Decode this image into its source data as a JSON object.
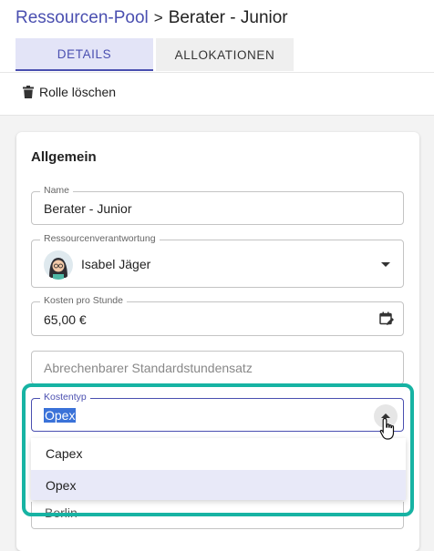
{
  "breadcrumb": {
    "parent": "Ressourcen-Pool",
    "separator": ">",
    "current": "Berater - Junior"
  },
  "tabs": [
    {
      "label": "DETAILS",
      "active": true
    },
    {
      "label": "ALLOKATIONEN",
      "active": false
    }
  ],
  "toolbar": {
    "delete_label": "Rolle löschen",
    "delete_icon": "trash-icon"
  },
  "section": {
    "title": "Allgemein"
  },
  "fields": {
    "name": {
      "label": "Name",
      "value": "Berater - Junior"
    },
    "owner": {
      "label": "Ressourcenverantwortung",
      "value": "Isabel Jäger",
      "icon": "chevron-down-icon"
    },
    "cost": {
      "label": "Kosten pro Stunde",
      "value": "65,00 €",
      "icon": "calendar-edit-icon"
    },
    "rate": {
      "placeholder": "Abrechenbarer Standardstundensatz"
    },
    "costtype": {
      "label": "Kostentyp",
      "value": "Opex",
      "icon": "chevron-up-icon"
    },
    "location": {
      "value": "Berlin"
    }
  },
  "dropdown": {
    "options": [
      "Capex",
      "Opex"
    ],
    "selected": "Opex"
  },
  "colors": {
    "accent": "#4a4fb0",
    "highlight": "#17b3a3",
    "selection": "#3a72d8"
  }
}
